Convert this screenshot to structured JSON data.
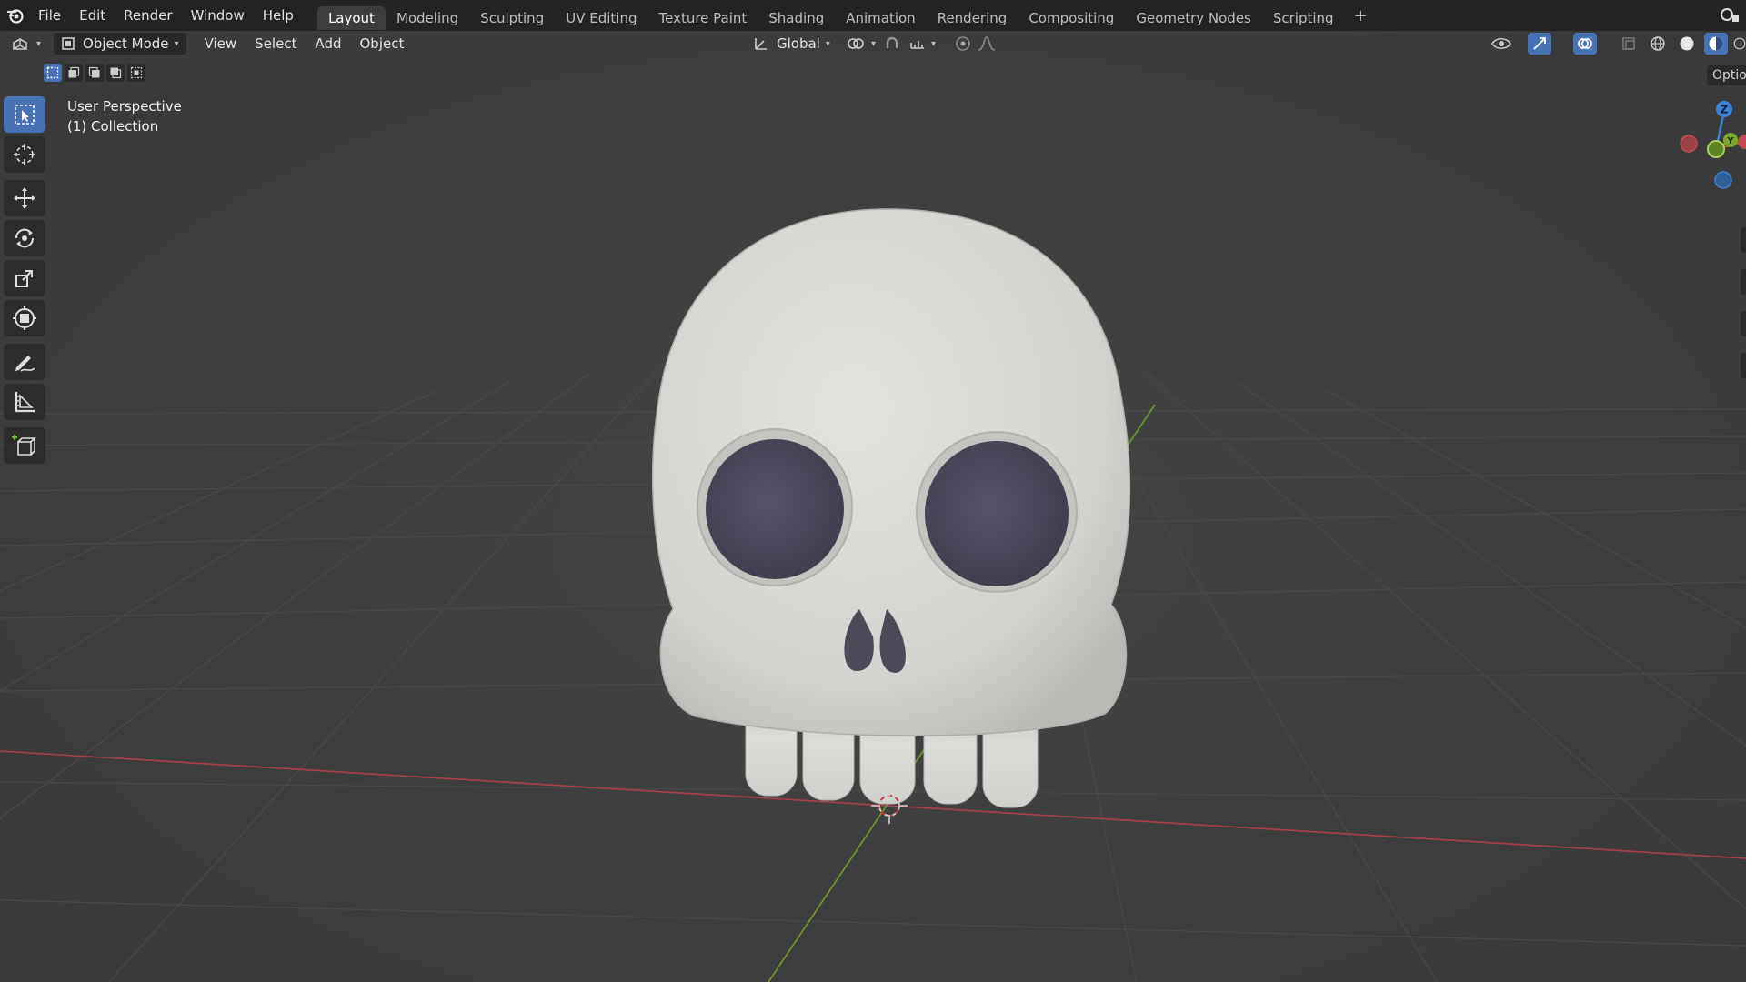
{
  "topbar": {
    "menus": [
      "File",
      "Edit",
      "Render",
      "Window",
      "Help"
    ],
    "workspaces": [
      "Layout",
      "Modeling",
      "Sculpting",
      "UV Editing",
      "Texture Paint",
      "Shading",
      "Animation",
      "Rendering",
      "Compositing",
      "Geometry Nodes",
      "Scripting"
    ],
    "active_workspace": "Layout",
    "add_tab": "+"
  },
  "header": {
    "mode": "Object Mode",
    "view": "View",
    "select": "Select",
    "add": "Add",
    "object": "Object",
    "orientation": "Global",
    "options": "Options"
  },
  "viewport": {
    "perspective": "User Perspective",
    "collection": "(1) Collection"
  },
  "gizmo": {
    "z_label": "Z",
    "y_label": "Y"
  },
  "colors": {
    "accent": "#4772b3",
    "x_axis": "#c44a54",
    "y_axis": "#79a82c",
    "z_axis": "#3c82d6",
    "skull": "#d6d6d3",
    "eye": "#4e4c5c"
  },
  "icons": [
    "blender-logo",
    "editor-type-icon",
    "object-mode-icon",
    "orientation-icon",
    "pivot-icon",
    "snap-icon",
    "proportional-icon",
    "select-box-icon",
    "cursor-icon",
    "move-icon",
    "rotate-icon",
    "scale-icon",
    "transform-icon",
    "annotate-icon",
    "measure-icon",
    "add-cube-icon",
    "visibility-icon",
    "gizmo-icon",
    "overlay-icon",
    "xray-icon",
    "wireframe-shading-icon",
    "solid-shading-icon",
    "material-shading-icon",
    "rendered-shading-icon"
  ]
}
